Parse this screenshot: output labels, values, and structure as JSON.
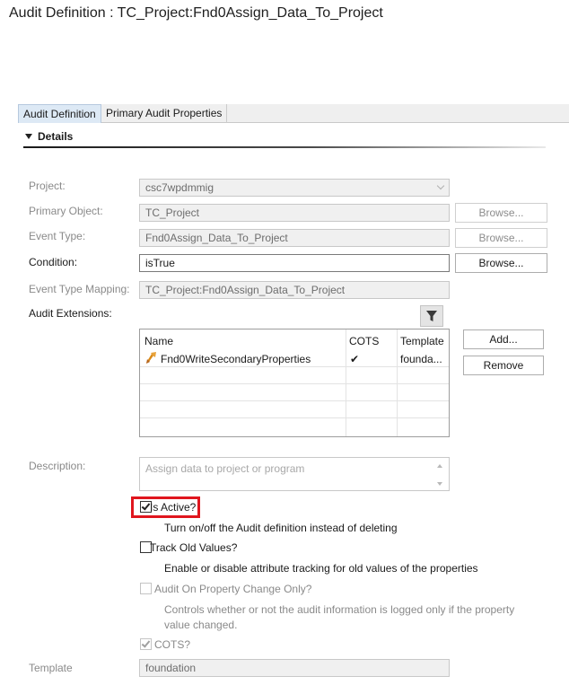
{
  "header": {
    "title": "Audit Definition : TC_Project:Fnd0Assign_Data_To_Project"
  },
  "tabs": [
    {
      "label": "Audit Definition",
      "active": true
    },
    {
      "label": "Primary Audit Properties",
      "active": false
    }
  ],
  "section": {
    "label": "Details",
    "expanded": true
  },
  "form": {
    "project": {
      "label": "Project:",
      "value": "csc7wpdmmig"
    },
    "primary_object": {
      "label": "Primary Object:",
      "value": "TC_Project",
      "browse": "Browse..."
    },
    "event_type": {
      "label": "Event Type:",
      "value": "Fnd0Assign_Data_To_Project",
      "browse": "Browse..."
    },
    "condition": {
      "label": "Condition:",
      "value": "isTrue",
      "browse": "Browse..."
    },
    "event_type_mapping": {
      "label": "Event Type Mapping:",
      "value": "TC_Project:Fnd0Assign_Data_To_Project"
    },
    "audit_extensions": {
      "label": "Audit Extensions:",
      "filter_icon": "filter-icon",
      "columns": [
        "Name",
        "COTS",
        "Template"
      ],
      "rows": [
        {
          "name": "Fnd0WriteSecondaryProperties",
          "icon": "extension-icon",
          "cots": "✔",
          "template": "founda..."
        }
      ],
      "add_label": "Add...",
      "remove_label": "Remove"
    },
    "description": {
      "label": "Description:",
      "placeholder": "Assign data to project or program"
    },
    "is_active": {
      "label": "Is Active?",
      "checked": true,
      "help": "Turn on/off the Audit definition instead of deleting"
    },
    "track_old_values": {
      "label": "Track Old Values?",
      "checked": false,
      "help": "Enable or disable attribute tracking for old values of the properties"
    },
    "audit_on_property_change": {
      "label": "Audit On Property Change Only?",
      "checked": false,
      "enabled": false,
      "help": "Controls whether or not the audit information is logged only if the property value changed."
    },
    "cots": {
      "label": "COTS?",
      "checked": true,
      "enabled": false
    },
    "template": {
      "label": "Template",
      "value": "foundation"
    }
  },
  "colors": {
    "highlight": "#e0161e",
    "active_tab": "#dde9f5"
  }
}
